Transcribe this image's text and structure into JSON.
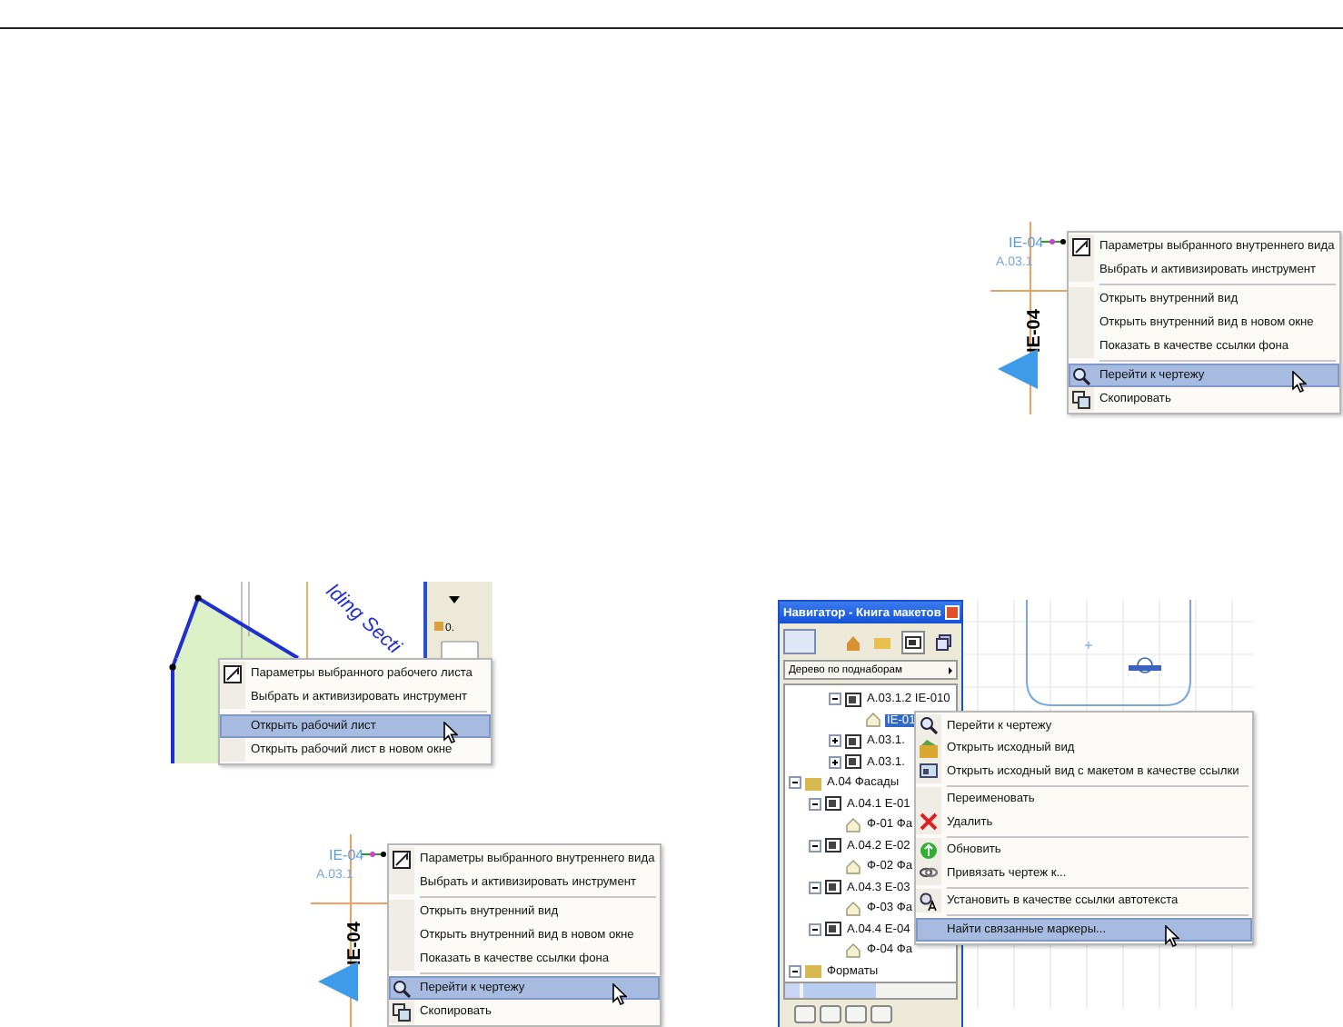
{
  "figures": [
    {
      "kind": "marker",
      "marker": {
        "tag": "IE-04",
        "ref": "A.03.1",
        "title": "IE-04"
      },
      "menu": [
        {
          "label": "Параметры выбранного внутреннего вида",
          "kind": "params",
          "selected": false,
          "divider": false
        },
        {
          "label": "Выбрать и активизировать инструмент",
          "kind": "plain",
          "selected": false,
          "divider": false
        },
        {
          "label": "Открыть внутренний вид",
          "kind": "plain",
          "selected": false,
          "divider": true
        },
        {
          "label": "Открыть внутренний вид в новом окне",
          "kind": "plain",
          "selected": false,
          "divider": false
        },
        {
          "label": "Показать в качестве ссылки фона",
          "kind": "plain",
          "selected": false,
          "divider": false
        },
        {
          "label": "Перейти к чертежу",
          "kind": "zoom",
          "selected": true,
          "divider": true
        },
        {
          "label": "Скопировать",
          "kind": "copy",
          "selected": false,
          "divider": false
        }
      ]
    },
    {
      "kind": "worksheet",
      "section_label": "lding Secti",
      "side_value": "0.",
      "menu": [
        {
          "label": "Параметры выбранного рабочего листа",
          "kind": "params",
          "selected": false,
          "divider": false
        },
        {
          "label": "Выбрать и активизировать инструмент",
          "kind": "plain",
          "selected": false,
          "divider": false
        },
        {
          "label": "Открыть рабочий лист",
          "kind": "plain",
          "selected": true,
          "divider": true
        },
        {
          "label": "Открыть рабочий лист в новом окне",
          "kind": "plain",
          "selected": false,
          "divider": false
        }
      ]
    },
    {
      "kind": "marker",
      "marker": {
        "tag": "IE-04",
        "ref": "A.03.1",
        "title": "IE-04"
      },
      "menu": [
        {
          "label": "Параметры выбранного внутреннего вида",
          "kind": "params",
          "selected": false,
          "divider": false
        },
        {
          "label": "Выбрать и активизировать инструмент",
          "kind": "plain",
          "selected": false,
          "divider": false
        },
        {
          "label": "Открыть внутренний вид",
          "kind": "plain",
          "selected": false,
          "divider": true
        },
        {
          "label": "Открыть внутренний вид в новом окне",
          "kind": "plain",
          "selected": false,
          "divider": false
        },
        {
          "label": "Показать в качестве ссылки фона",
          "kind": "plain",
          "selected": false,
          "divider": false
        },
        {
          "label": "Перейти к чертежу",
          "kind": "zoom",
          "selected": true,
          "divider": true
        },
        {
          "label": "Скопировать",
          "kind": "copy",
          "selected": false,
          "divider": false
        }
      ]
    },
    {
      "kind": "navigator",
      "navigator": {
        "title": "Навигатор - Книга макетов",
        "view": "Дерево по поднаборам",
        "tree": [
          {
            "children": [
              {
                "children": [
                  {
                    "label": "A.03.1.2 IE-010",
                    "kind": "sheet",
                    "expanded": true,
                    "selected": false,
                    "children": [
                      {
                        "label": "IE-01",
                        "kind": "view",
                        "selected": true
                      }
                    ]
                  },
                  {
                    "label": "A.03.1.",
                    "kind": "sheet",
                    "expanded": false,
                    "selected": false
                  },
                  {
                    "label": "A.03.1.",
                    "kind": "sheet",
                    "expanded": false,
                    "selected": false
                  }
                ]
              }
            ]
          },
          {
            "label": "A.04 Фасады",
            "kind": "folder",
            "expanded": true,
            "selected": false,
            "children": [
              {
                "label": "A.04.1 E-01",
                "kind": "sheet",
                "expanded": true,
                "selected": false,
                "children": [
                  {
                    "label": "Ф-01 Фа",
                    "kind": "view",
                    "selected": false
                  }
                ]
              },
              {
                "label": "A.04.2 E-02",
                "kind": "sheet",
                "expanded": true,
                "selected": false,
                "children": [
                  {
                    "label": "Ф-02 Фа",
                    "kind": "view",
                    "selected": false
                  }
                ]
              },
              {
                "label": "A.04.3 E-03",
                "kind": "sheet",
                "expanded": true,
                "selected": false,
                "children": [
                  {
                    "label": "Ф-03 Фа",
                    "kind": "view",
                    "selected": false
                  }
                ]
              },
              {
                "label": "A.04.4 E-04",
                "kind": "sheet",
                "expanded": true,
                "selected": false,
                "children": [
                  {
                    "label": "Ф-04 Фа",
                    "kind": "view",
                    "selected": false
                  }
                ]
              }
            ]
          },
          {
            "label": "Форматы",
            "kind": "folder",
            "expanded": true,
            "selected": false
          }
        ]
      },
      "menu": [
        {
          "label": "Перейти к чертежу",
          "kind": "zoom",
          "selected": false,
          "divider": false
        },
        {
          "label": "Открыть исходный вид",
          "kind": "open",
          "selected": false,
          "divider": false
        },
        {
          "label": "Открыть исходный вид с макетом в качестве ссылки",
          "kind": "image",
          "selected": false,
          "divider": false
        },
        {
          "label": "Переименовать",
          "kind": "plain",
          "selected": false,
          "divider": true
        },
        {
          "label": "Удалить",
          "kind": "delete",
          "selected": false,
          "divider": false
        },
        {
          "label": "Обновить",
          "kind": "update",
          "selected": false,
          "divider": true
        },
        {
          "label": "Привязать чертеж к...",
          "kind": "link",
          "selected": false,
          "divider": false
        },
        {
          "label": "Установить в качестве ссылки автотекста",
          "kind": "autotext",
          "selected": false,
          "divider": true
        },
        {
          "label": "Найти связанные маркеры...",
          "kind": "plain",
          "selected": true,
          "divider": true
        }
      ]
    }
  ]
}
